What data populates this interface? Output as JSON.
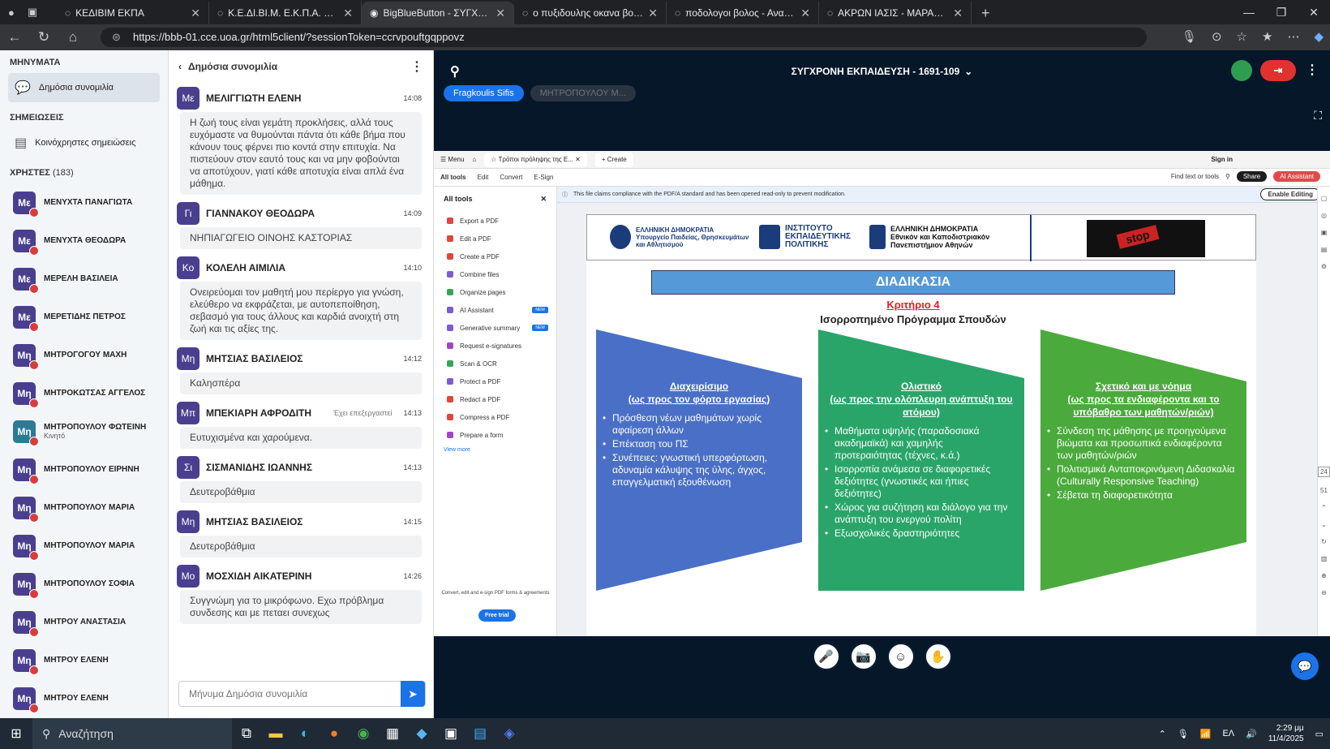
{
  "browser": {
    "tabs": [
      {
        "label": "ΚΕΔΙΒΙΜ ΕΚΠΑ",
        "active": false
      },
      {
        "label": "Κ.Ε.ΔΙ.ΒΙ.Μ. Ε.Κ.Π.Α. eClass-Cybele",
        "active": false
      },
      {
        "label": "BigBlueButton - ΣΥΓΧΡΟΝΗ",
        "active": true
      },
      {
        "label": "ο πυξιδουλης οκανα βολου - Ανα",
        "active": false
      },
      {
        "label": "ποδολογοι βολος - Αναζήτηση",
        "active": false
      },
      {
        "label": "ΑΚΡΩΝ ΙΑΣΙΣ - ΜΑΡΑΓΚΟΥ ΑΝΑΡ",
        "active": false
      }
    ],
    "url": "https://bbb-01.cce.uoa.gr/html5client/?sessionToken=ccrvpouftgqppovz"
  },
  "sidebar": {
    "messages_header": "ΜΗΝΥΜΑΤΑ",
    "public_chat": "Δημόσια συνομιλία",
    "notes_header": "ΣΗΜΕΙΩΣΕΙΣ",
    "shared_notes": "Κοινόχρηστες σημειώσεις",
    "users_header": "ΧΡΗΣΤΕΣ",
    "users_count": "(183)",
    "users": [
      {
        "initials": "Με",
        "name": "ΜΕΝΥΧΤΑ ΠΑΝΑΓΙΩΤΑ",
        "sub": ""
      },
      {
        "initials": "Με",
        "name": "ΜΕΝΥΧΤΑ ΘΕΟΔΩΡΑ",
        "sub": ""
      },
      {
        "initials": "Με",
        "name": "ΜΕΡΕΛΗ ΒΑΣΙΛΕΙΑ",
        "sub": ""
      },
      {
        "initials": "Με",
        "name": "ΜΕΡΕΤΙΔΗΣ ΠΕΤΡΟΣ",
        "sub": ""
      },
      {
        "initials": "Μη",
        "name": "ΜΗΤΡΟΓΟΓΟΥ ΜΑΧΗ",
        "sub": ""
      },
      {
        "initials": "Μη",
        "name": "ΜΗΤΡΟΚΩΤΣΑΣ ΑΓΓΕΛΟΣ",
        "sub": ""
      },
      {
        "initials": "Μη",
        "name": "ΜΗΤΡΟΠΟΥΛΟΥ ΦΩΤΕΙΝΗ",
        "sub": "Κινητό"
      },
      {
        "initials": "Μη",
        "name": "ΜΗΤΡΟΠΟΥΛΟΥ ΕΙΡΗΝΗ",
        "sub": ""
      },
      {
        "initials": "Μη",
        "name": "ΜΗΤΡΟΠΟΥΛΟΥ ΜΑΡΙΑ",
        "sub": ""
      },
      {
        "initials": "Μη",
        "name": "ΜΗΤΡΟΠΟΥΛΟΥ ΜΑΡΙΑ",
        "sub": ""
      },
      {
        "initials": "Μη",
        "name": "ΜΗΤΡΟΠΟΥΛΟΥ ΣΟΦΙΑ",
        "sub": ""
      },
      {
        "initials": "Μη",
        "name": "ΜΗΤΡΟΥ ΑΝΑΣΤΑΣΙΑ",
        "sub": ""
      },
      {
        "initials": "Μη",
        "name": "ΜΗΤΡΟΥ ΕΛΕΝΗ",
        "sub": ""
      },
      {
        "initials": "Μη",
        "name": "ΜΗΤΡΟΥ ΕΛΕΝΗ",
        "sub": ""
      }
    ]
  },
  "chat": {
    "title": "Δημόσια συνομιλία",
    "messages": [
      {
        "initials": "Με",
        "name": "ΜΕΛΙΓΓΙΩΤΗ ΕΛΕΝΗ",
        "time": "14:08",
        "edit": "",
        "text": "Η ζωή τους είναι γεμάτη προκλήσεις, αλλά τους ευχόμαστε να θυμούνται πάντα ότι κάθε βήμα που κάνουν τους φέρνει πιο κοντά στην επιτυχία. Να πιστεύουν στον εαυτό τους και να μην φοβούνται να αποτύχουν, γιατί κάθε αποτυχία είναι απλά ένα μάθημα."
      },
      {
        "initials": "Γι",
        "name": "ΓΙΑΝΝΑΚΟΥ ΘΕΟΔΩΡΑ",
        "time": "14:09",
        "edit": "",
        "text": "ΝΗΠΙΑΓΩΓΕΙΟ ΟΙΝΟΗΣ ΚΑΣΤΟΡΙΑΣ"
      },
      {
        "initials": "Κο",
        "name": "ΚΟΛΕΛΗ ΑΙΜΙΛΙΑ",
        "time": "14:10",
        "edit": "",
        "text": "Ονειρεύομαι τον μαθητή μου περίεργο για γνώση, ελεύθερο να εκφράζεται, με αυτοπεποίθηση, σεβασμό για τους άλλους και καρδιά ανοιχτή στη ζωή και τις αξίες της."
      },
      {
        "initials": "Μη",
        "name": "ΜΗΤΣΙΑΣ ΒΑΣΙΛΕΙΟΣ",
        "time": "14:12",
        "edit": "",
        "text": "Καλησπέρα"
      },
      {
        "initials": "Μπ",
        "name": "ΜΠΕΚΙΑΡΗ ΑΦΡΟΔΙΤΗ",
        "time": "14:13",
        "edit": "Έχει επεξεργαστεί",
        "text": "Ευτυχισμένα και χαρούμενα."
      },
      {
        "initials": "Σι",
        "name": "ΣΙΣΜΑΝΙΔΗΣ ΙΩΑΝΝΗΣ",
        "time": "14:13",
        "edit": "",
        "text": "Δευτεροβάθμια"
      },
      {
        "initials": "Μη",
        "name": "ΜΗΤΣΙΑΣ ΒΑΣΙΛΕΙΟΣ",
        "time": "14:15",
        "edit": "",
        "text": "Δευτεροβάθμια"
      },
      {
        "initials": "Μο",
        "name": "ΜΟΣΧΙΔΗ ΑΙΚΑΤΕΡΙΝΗ",
        "time": "14:26",
        "edit": "",
        "text": "Συγγνώμη για το μικρόφωνο. Εχω πρόβλημα συνδεσης και με πεταει συνεχως"
      }
    ],
    "input_placeholder": "Μήνυμα Δημόσια συνομιλία"
  },
  "meeting": {
    "title": "ΣΥΓΧΡΟΝΗ ΕΚΠΑΙΔΕΥΣΗ - 1691-109",
    "talkers": [
      "Fragkoulis Sifis",
      "ΜΗΤΡΟΠΟΥΛΟΥ Μ..."
    ]
  },
  "acrobat": {
    "tab": "Τρόποι πρόληψης της Ε...",
    "create": "Create",
    "menu": "Menu",
    "sign_in": "Sign in",
    "menu_items": [
      "All tools",
      "Edit",
      "Convert",
      "E-Sign"
    ],
    "find": "Find text or tools",
    "share": "Share",
    "ai_assistant": "AI Assistant",
    "all_tools": "All tools",
    "tools": [
      {
        "label": "Export a PDF",
        "color": "#e0473a",
        "new": false
      },
      {
        "label": "Edit a PDF",
        "color": "#e0473a",
        "new": false
      },
      {
        "label": "Create a PDF",
        "color": "#e0473a",
        "new": false
      },
      {
        "label": "Combine files",
        "color": "#7b5cd6",
        "new": false
      },
      {
        "label": "Organize pages",
        "color": "#3aa655",
        "new": false
      },
      {
        "label": "AI Assistant",
        "color": "#7b5cd6",
        "new": true
      },
      {
        "label": "Generative summary",
        "color": "#7b5cd6",
        "new": true
      },
      {
        "label": "Request e-signatures",
        "color": "#a144c8",
        "new": false
      },
      {
        "label": "Scan & OCR",
        "color": "#3aa655",
        "new": false
      },
      {
        "label": "Protect a PDF",
        "color": "#7b5cd6",
        "new": false
      },
      {
        "label": "Redact a PDF",
        "color": "#e0473a",
        "new": false
      },
      {
        "label": "Compress a PDF",
        "color": "#e0473a",
        "new": false
      },
      {
        "label": "Prepare a form",
        "color": "#a144c8",
        "new": false
      }
    ],
    "new_badge": "NEW",
    "view_more": "View more",
    "foot_text": "Convert, edit and e-sign PDF forms & agreements",
    "free_trial": "Free trial",
    "notice": "This file claims compliance with the PDF/A standard and has been opened read-only to prevent modification.",
    "enable_editing": "Enable Editing",
    "page_number": "24",
    "page_total": "51"
  },
  "slide": {
    "logo1": "ΕΛΛΗΝΙΚΗ ΔΗΜΟΚΡΑΤΙΑ\nΥπουργείο Παιδείας, Θρησκευμάτων\nκαι Αθλητισμού",
    "logo2": "ΙΝΣΤΙΤΟΥΤΟ\nΕΚΠΑΙΔΕΥΤΙΚΗΣ\nΠΟΛΙΤΙΚΗΣ",
    "logo3": "ΕΛΛΗΝΙΚΗ ΔΗΜΟΚΡΑΤΙΑ\nΕθνικόν και Καποδιστριακόν\nΠανεπιστήμιον Αθηνών",
    "stop": "stop",
    "heading": "ΔΙΑΔΙΚΑΣΙΑ",
    "criterion": "Κριτήριο 4",
    "subtitle": "Ισορροπημένο Πρόγραμμα Σπουδών",
    "columns": [
      {
        "title": "Διαχειρίσιμο\n(ως προς τον φόρτο εργασίας)",
        "color": "#4a6fc6",
        "items": [
          "Πρόσθεση νέων μαθημάτων χωρίς αφαίρεση άλλων",
          "Επέκταση του ΠΣ",
          "Συνέπειες: γνωστική υπερφόρτωση, αδυναμία κάλυψης της ύλης, άγχος, επαγγελματική εξουθένωση"
        ]
      },
      {
        "title": "Ολιστικό\n(ως προς την ολόπλευρη ανάπτυξη του ατόμου)",
        "color": "#2aa56a",
        "items": [
          "Μαθήματα υψηλής (παραδοσιακά ακαδημαϊκά) και χαμηλής προτεραιότητας (τέχνες, κ.ά.)",
          "Ισορροπία ανάμεσα σε διαφορετικές δεξιότητες (γνωστικές και ήπιες δεξιότητες)",
          "Χώρος για συζήτηση και διάλογο για την ανάπτυξη του ενεργού πολίτη",
          "Εξωσχολικές δραστηριότητες"
        ]
      },
      {
        "title": "Σχετικό και με νόημα\n(ως προς τα ενδιαφέροντα και το υπόβαθρο των μαθητών/ριών)",
        "color": "#4aaa3c",
        "items": [
          "Σύνδεση της μάθησης με προηγούμενα βιώματα και προσωπικά ενδιαφέροντα των μαθητών/ριών",
          "Πολιτισμικά Ανταποκρινόμενη Διδασκαλία (Culturally Responsive Teaching)",
          "Σέβεται τη διαφορετικότητα"
        ]
      }
    ]
  },
  "taskbar": {
    "search": "Αναζήτηση",
    "lang": "ΕΛ",
    "time": "2:29 μμ",
    "date": "11/4/2025"
  }
}
